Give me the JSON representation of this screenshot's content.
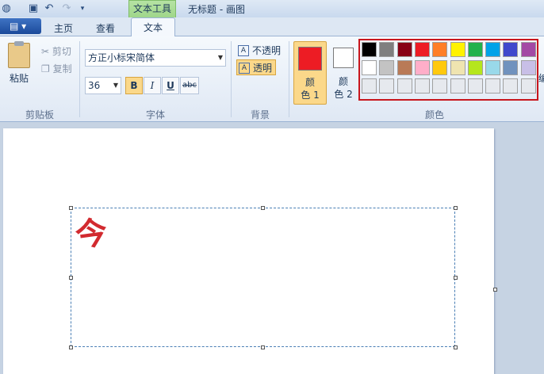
{
  "window": {
    "title": "无标题 - 画图",
    "context_tab": "文本工具"
  },
  "tabs": {
    "home": "主页",
    "view": "查看",
    "text": "文本"
  },
  "clipboard": {
    "paste": "粘贴",
    "cut": "剪切",
    "copy": "复制",
    "group": "剪贴板"
  },
  "font": {
    "family": "方正小标宋简体",
    "size": "36",
    "bold": "B",
    "italic": "I",
    "underline": "U",
    "strike": "abc",
    "group": "字体"
  },
  "background": {
    "opaque": "不透明",
    "transparent": "透明",
    "group": "背景"
  },
  "colors": {
    "color1_line1": "颜",
    "color1_line2": "色 1",
    "color2_line1": "颜",
    "color2_line2": "色 2",
    "group": "颜色",
    "edit_partial": "编",
    "color1_value": "#ed1c24",
    "color2_value": "#ffffff",
    "palette": [
      [
        "#000000",
        "#7f7f7f",
        "#880015",
        "#ed1c24",
        "#ff7f27",
        "#fff200",
        "#22b14c",
        "#00a2e8",
        "#3f48cc",
        "#a349a4"
      ],
      [
        "#ffffff",
        "#c3c3c3",
        "#b97a57",
        "#ffaec9",
        "#ffc90e",
        "#efe4b0",
        "#b5e61d",
        "#99d9ea",
        "#7092be",
        "#c8bfe7"
      ],
      [
        "#e6e9ee",
        "#e6e9ee",
        "#e6e9ee",
        "#e6e9ee",
        "#e6e9ee",
        "#e6e9ee",
        "#e6e9ee",
        "#e6e9ee",
        "#e6e9ee",
        "#e6e9ee"
      ]
    ]
  },
  "canvas": {
    "text": "今"
  }
}
